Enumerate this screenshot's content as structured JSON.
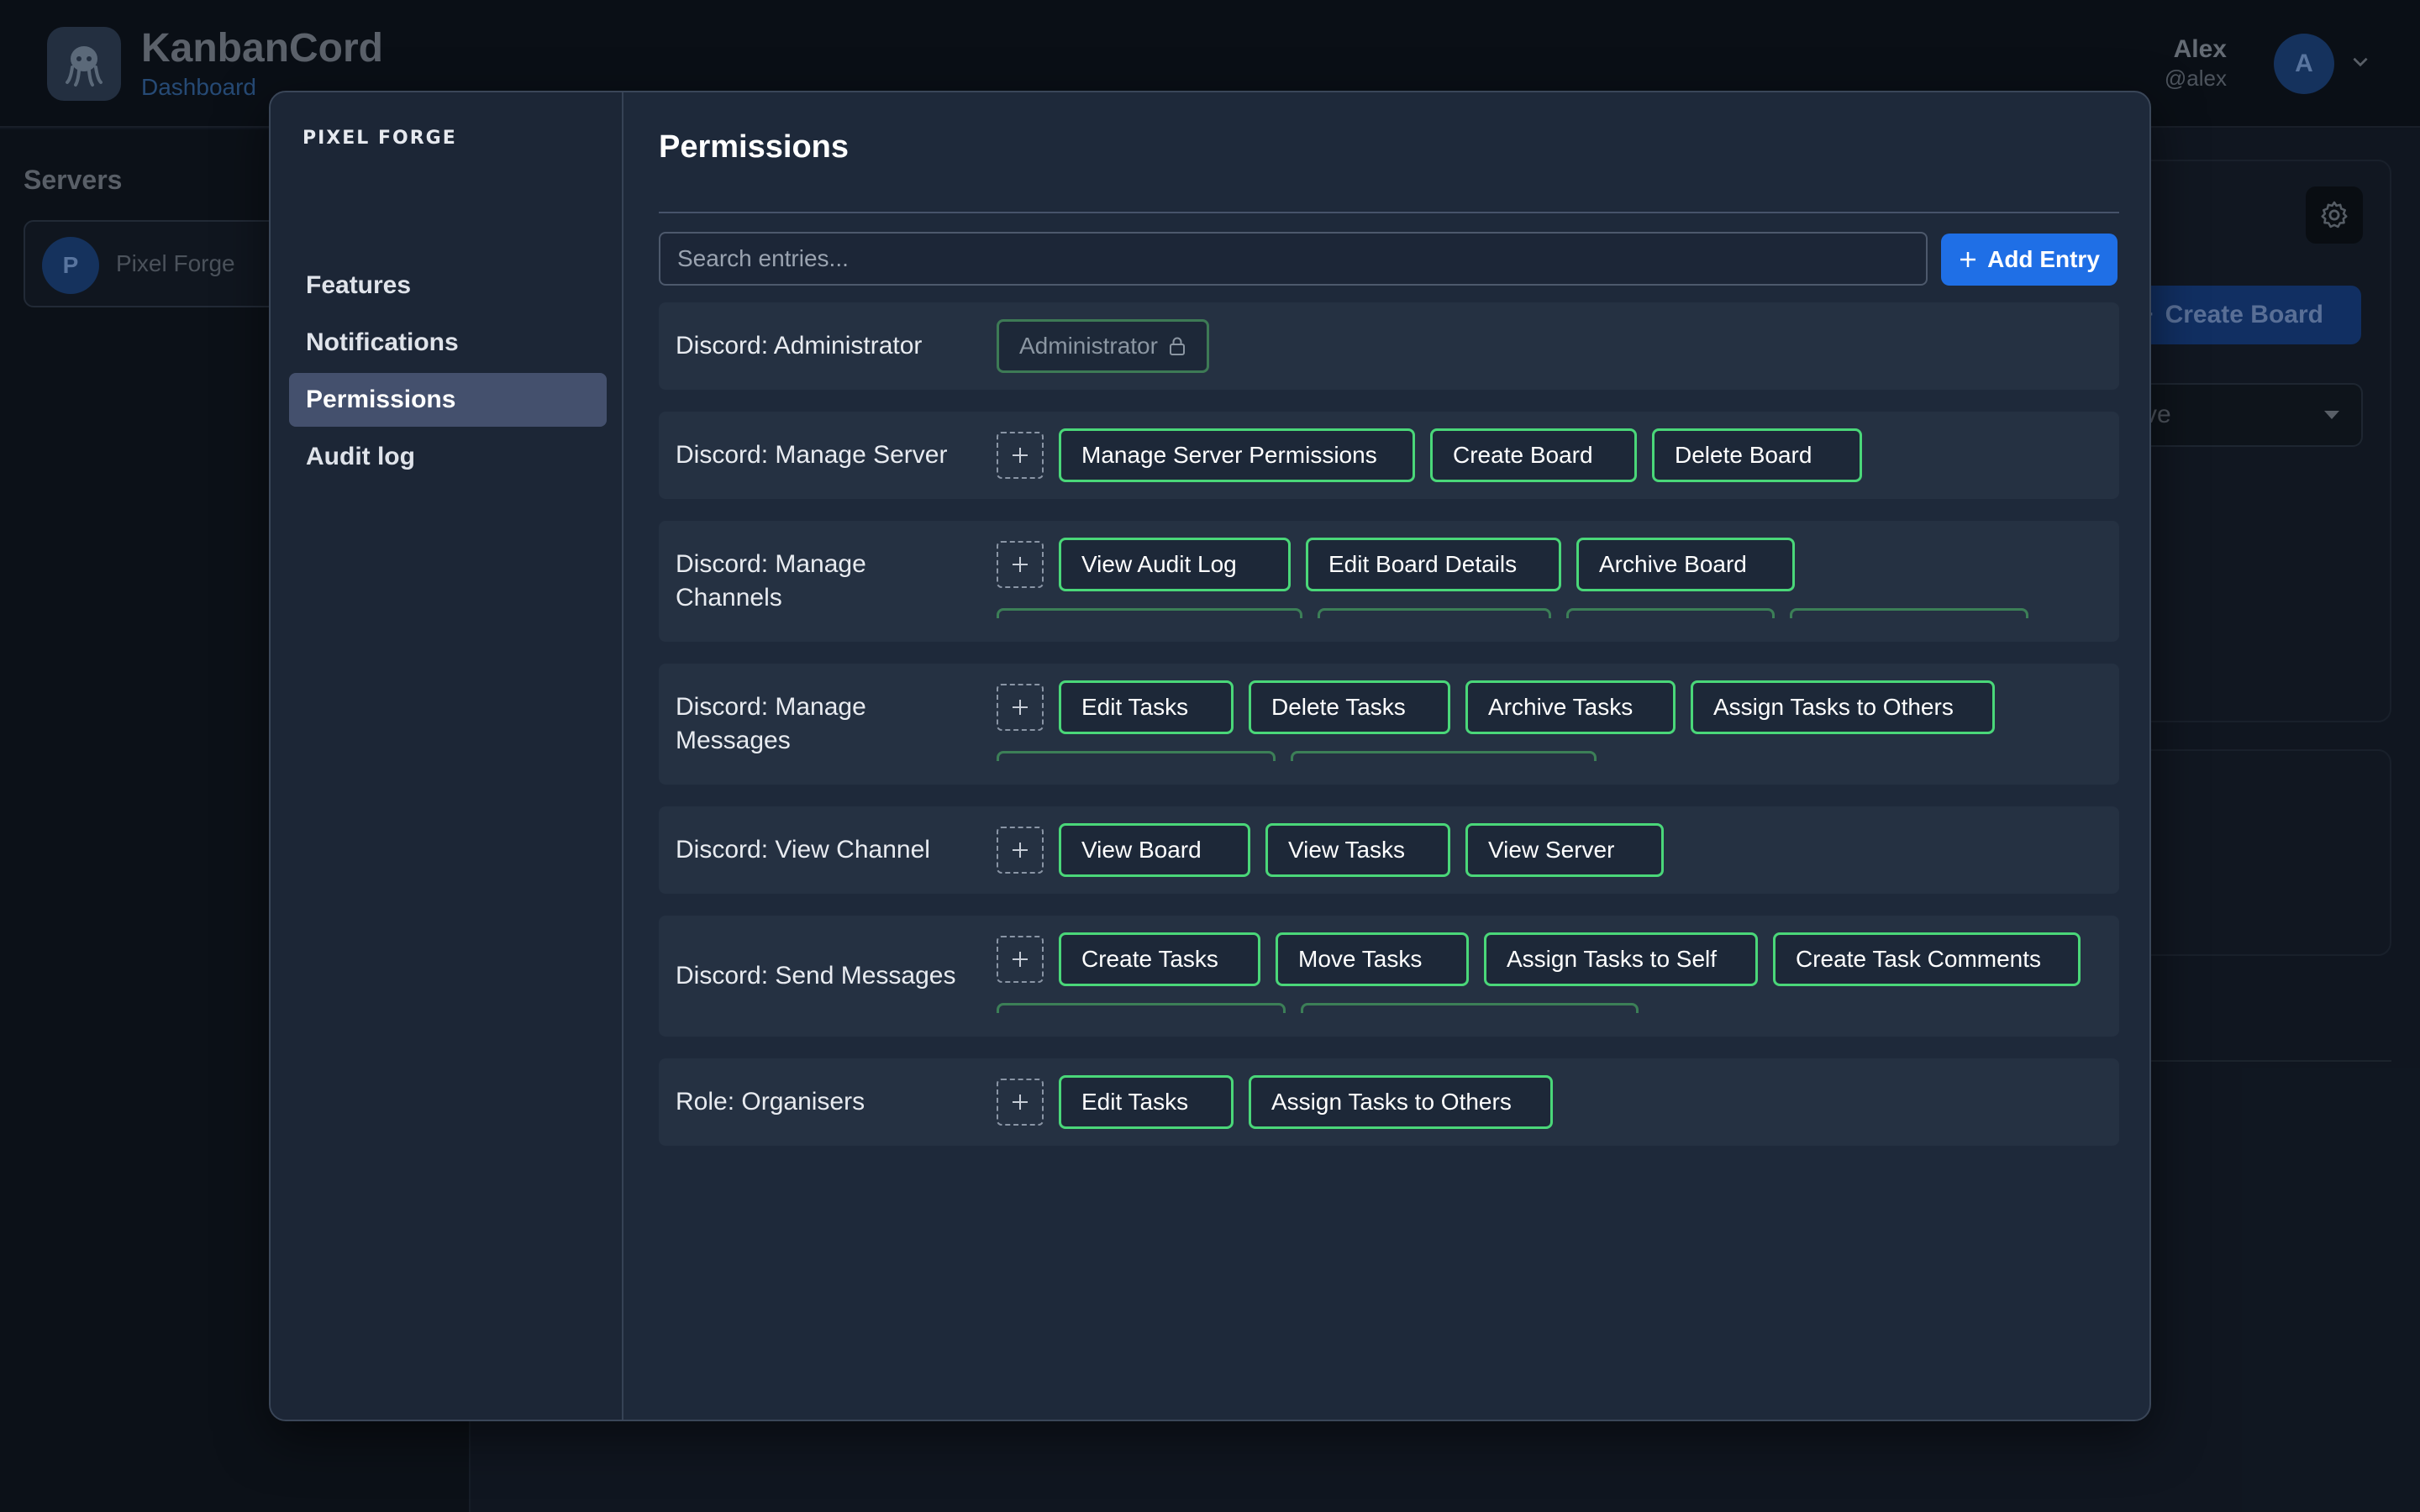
{
  "app": {
    "title": "KanbanCord",
    "subtitle": "Dashboard"
  },
  "user": {
    "name": "Alex",
    "handle": "@alex",
    "avatar_letter": "A"
  },
  "servers": {
    "title": "Servers",
    "items": [
      {
        "letter": "P",
        "name": "Pixel Forge"
      }
    ]
  },
  "background": {
    "create_board_label": "Create Board",
    "status_value": "ctive"
  },
  "modal": {
    "org": "PIXEL FORGE",
    "nav": [
      "Features",
      "Notifications",
      "Permissions",
      "Audit log"
    ],
    "active_nav": "Permissions",
    "title": "Permissions",
    "search_placeholder": "Search entries...",
    "add_entry_label": "Add Entry",
    "entries": [
      {
        "label": "Discord: Administrator",
        "permissions": [
          "Administrator"
        ]
      },
      {
        "label": "Discord: Manage Server",
        "permissions": [
          "Manage Server Permissions",
          "Create Board",
          "Delete Board"
        ]
      },
      {
        "label": "Discord: Manage Channels",
        "permissions": [
          "View Audit Log",
          "Edit Board Details",
          "Archive Board"
        ]
      },
      {
        "label": "Discord: Manage Messages",
        "permissions": [
          "Edit Tasks",
          "Delete Tasks",
          "Archive Tasks",
          "Assign Tasks to Others"
        ]
      },
      {
        "label": "Discord: View Channel",
        "permissions": [
          "View Board",
          "View Tasks",
          "View Server"
        ]
      },
      {
        "label": "Discord: Send Messages",
        "permissions": [
          "Create Tasks",
          "Move Tasks",
          "Assign Tasks to Self",
          "Create Task Comments"
        ]
      },
      {
        "label": "Role: Organisers",
        "permissions": [
          "Edit Tasks",
          "Assign Tasks to Others"
        ]
      }
    ]
  },
  "colors": {
    "accent": "#1f6fe6",
    "chip_border": "#4ad779",
    "active_nav": "#44506d"
  },
  "icons": [
    "octopus-logo-icon",
    "chevron-down-icon",
    "gear-icon",
    "plus-icon",
    "close-icon",
    "lock-icon"
  ]
}
